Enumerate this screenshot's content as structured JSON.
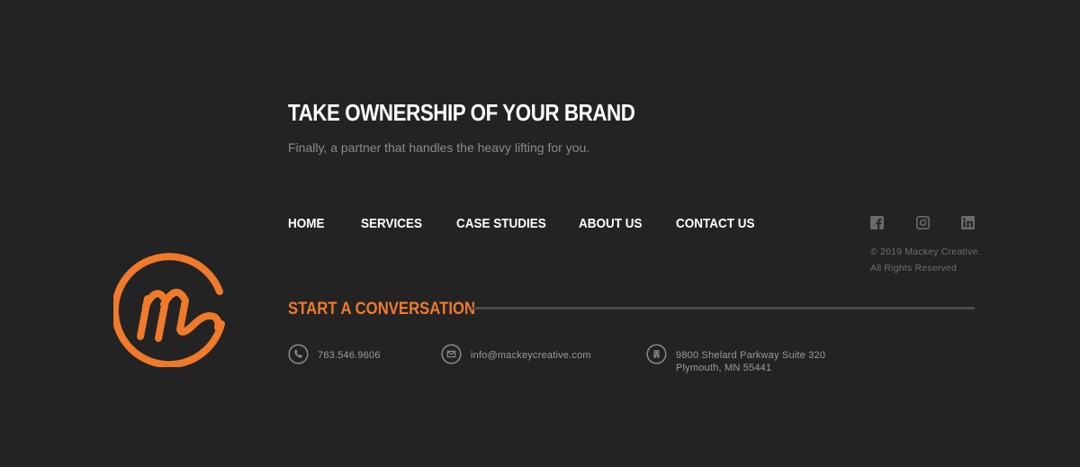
{
  "colors": {
    "background": "#232323",
    "accent": "#f07a2a",
    "text": "#ffffff",
    "muted": "#8a8a8a"
  },
  "logo": {
    "icon": "mackey-creative-logo"
  },
  "hero": {
    "headline": "TAKE OWNERSHIP OF YOUR BRAND",
    "subline": "Finally, a partner that handles the heavy lifting for you."
  },
  "nav": {
    "items": [
      {
        "label": "HOME"
      },
      {
        "label": "SERVICES"
      },
      {
        "label": "CASE STUDIES"
      },
      {
        "label": "ABOUT US"
      },
      {
        "label": "CONTACT US"
      }
    ]
  },
  "social": {
    "icons": [
      "facebook-icon",
      "instagram-icon",
      "linkedin-icon"
    ]
  },
  "copyright": {
    "line1": "© 2019 Mackey Creative.",
    "line2": "All Rights Reserved"
  },
  "cta": {
    "label": "START A CONVERSATION"
  },
  "contact": {
    "phone": {
      "icon": "phone-icon",
      "value": "763.546.9606"
    },
    "email": {
      "icon": "email-icon",
      "value": "info@mackeycreative.com"
    },
    "address": {
      "icon": "building-icon",
      "line1": "9800 Shelard Parkway Suite 320",
      "line2": "Plymouth, MN 55441"
    }
  }
}
